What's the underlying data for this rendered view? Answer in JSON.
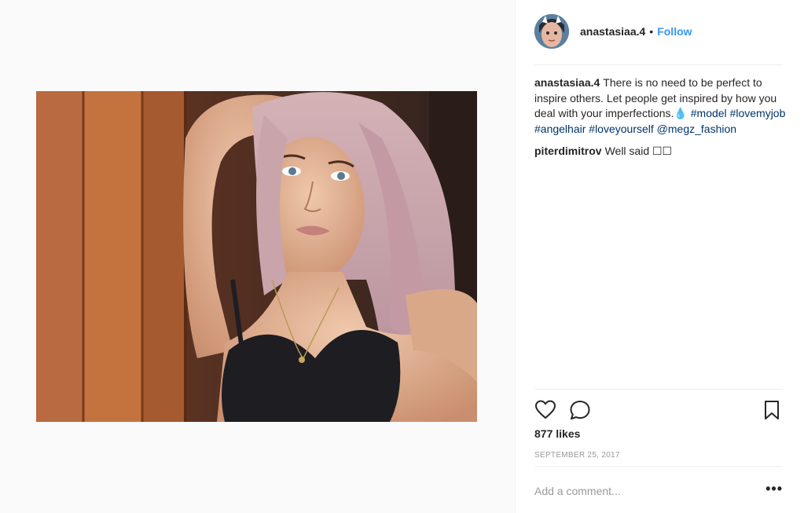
{
  "post": {
    "username": "anastasiaa.4",
    "separator": "•",
    "follow_label": "Follow",
    "caption_author": "anastasiaa.4",
    "caption_text": "There is no need to be perfect to inspire others. Let people get inspired by how you deal with your imperfections.💧",
    "hashtags": [
      "#model",
      "#lovemyjob",
      "#angelhair",
      "#loveyourself"
    ],
    "mention": "@megz_fashion",
    "comments": [
      {
        "author": "piterdimitrov",
        "text": "Well said ☐☐"
      }
    ],
    "likes_text": "877 likes",
    "date_text": "SEPTEMBER 25, 2017",
    "comment_placeholder": "Add a comment...",
    "more_label": "•••"
  },
  "icons": {
    "like": "heart-icon",
    "comment": "speech-bubble-icon",
    "save": "bookmark-icon"
  },
  "colors": {
    "link": "#3897f0",
    "hashtag": "#003569",
    "muted": "#999999",
    "text": "#262626",
    "divider": "#efefef"
  }
}
